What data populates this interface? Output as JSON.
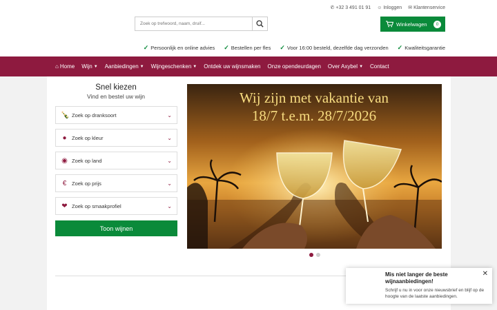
{
  "header": {
    "phone": "+32 3 491 01 91",
    "login": "Inloggen",
    "service": "Klantenservice",
    "search_placeholder": "Zoek op trefwoord, naam, druif...",
    "cart_label": "Winkelwagen",
    "cart_count": "0"
  },
  "usps": [
    "Persoonlijk en online advies",
    "Bestellen per fles",
    "Voor 16:00 besteld, dezelfde dag verzonden",
    "Kwaliteitsgarantie"
  ],
  "nav": [
    {
      "label": "Home",
      "icon": "home-icon",
      "dropdown": false
    },
    {
      "label": "Wijn",
      "dropdown": true
    },
    {
      "label": "Aanbiedingen",
      "dropdown": true
    },
    {
      "label": "Wijngeschenken",
      "dropdown": true
    },
    {
      "label": "Ontdek uw wijnsmaken",
      "dropdown": false
    },
    {
      "label": "Onze opendeurdagen",
      "dropdown": false
    },
    {
      "label": "Over Axybel",
      "dropdown": true
    },
    {
      "label": "Contact",
      "dropdown": false
    }
  ],
  "quick": {
    "title": "Snel kiezen",
    "subtitle": "Vind en bestel uw wijn",
    "filters": [
      {
        "label": "Zoek op dranksoort",
        "icon": "bottle-icon"
      },
      {
        "label": "Zoek op kleur",
        "icon": "drop-icon"
      },
      {
        "label": "Zoek op land",
        "icon": "globe-icon"
      },
      {
        "label": "Zoek op prijs",
        "icon": "euro-icon"
      },
      {
        "label": "Zoek op smaakprofiel",
        "icon": "glasses-icon"
      }
    ],
    "button": "Toon wijnen"
  },
  "banner": {
    "line1": "Wij zijn met vakantie van",
    "line2": "18/7 t.e.m. 28/7/2026",
    "active_slide": 1,
    "slides": 2
  },
  "popup": {
    "title": "Mis niet langer de beste wijnaanbiedingen!",
    "text": "Schrijf u nu in voor onze nieuwsbrief en blijf op de hoogte van de laatste aanbiedingen."
  },
  "colors": {
    "brand": "#8e1a3f",
    "accent": "#0a8a3a"
  }
}
